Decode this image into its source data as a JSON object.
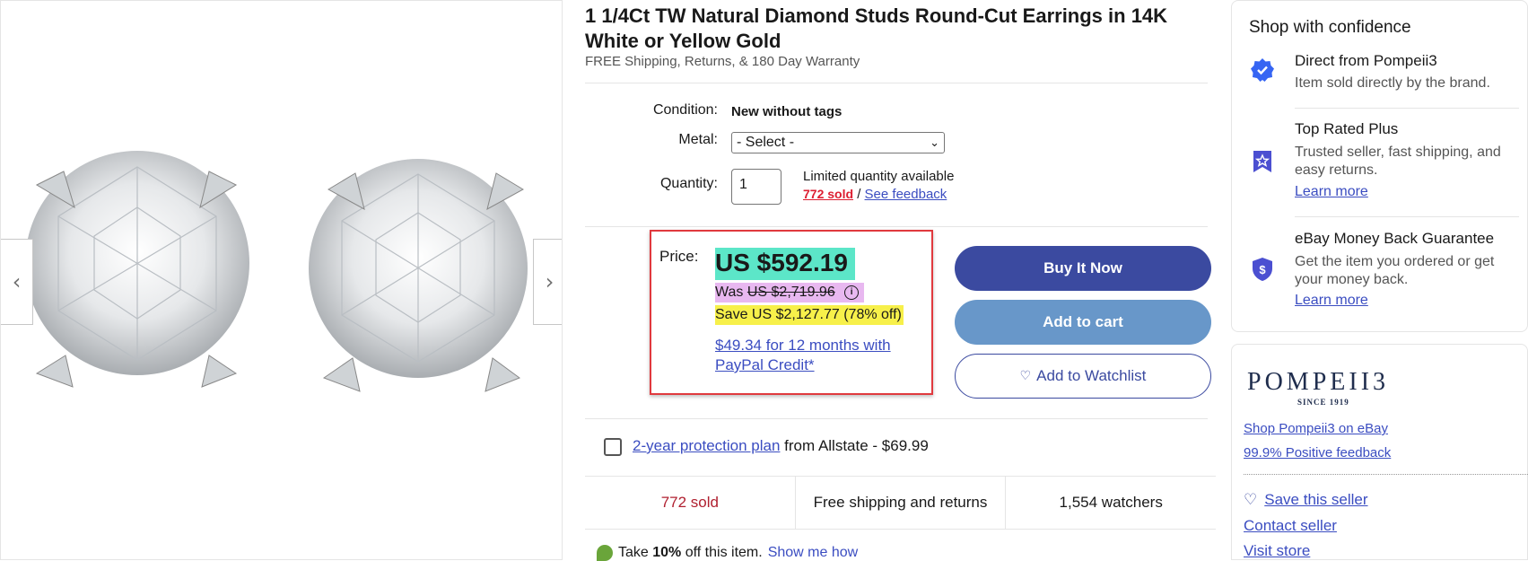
{
  "listing": {
    "title": "1 1/4Ct TW Natural Diamond Studs Round-Cut Earrings in 14K White or Yellow Gold",
    "subtitle": "FREE Shipping, Returns, & 180 Day Warranty"
  },
  "gallery": {
    "prev_icon": "‹",
    "next_icon": "›"
  },
  "details": {
    "condition_label": "Condition:",
    "condition_value": "New without tags",
    "metal_label": "Metal:",
    "metal_select": "- Select -",
    "quantity_label": "Quantity:",
    "quantity_value": "1",
    "limited_text": "Limited quantity available",
    "sold_link": "772 sold",
    "separator": "/",
    "feedback_link": "See feedback"
  },
  "price": {
    "label": "Price:",
    "main": "US $592.19",
    "was_prefix": "Was",
    "was_value": "US $2,719.96",
    "save": "Save US $2,127.77 (78% off)",
    "paypal": "$49.34 for 12 months with PayPal Credit*"
  },
  "actions": {
    "buy_now": "Buy It Now",
    "add_to_cart": "Add to cart",
    "watchlist_icon": "♡",
    "watchlist": "Add to Watchlist"
  },
  "protection": {
    "link": "2-year protection plan",
    "rest": " from Allstate - $69.99"
  },
  "stats": {
    "sold": "772 sold",
    "shipping": "Free shipping and returns",
    "watchers": "1,554 watchers"
  },
  "promo": {
    "prefix": "Take ",
    "bold": "10%",
    "suffix": " off this item.",
    "link": "Show me how"
  },
  "confidence": {
    "title": "Shop with confidence",
    "items": [
      {
        "title": "Direct from Pompeii3",
        "desc": "Item sold directly by the brand.",
        "link": ""
      },
      {
        "title": "Top Rated Plus",
        "desc": "Trusted seller, fast shipping, and easy returns.",
        "link": "Learn more"
      },
      {
        "title": "eBay Money Back Guarantee",
        "desc": "Get the item you ordered or get your money back.",
        "link": "Learn more"
      }
    ]
  },
  "seller": {
    "logo": "POMPEII3",
    "since": "SINCE 1919",
    "shop_link": "Shop Pompeii3 on eBay",
    "feedback_link": "99.9% Positive feedback",
    "save_icon": "♡",
    "save": "Save this seller",
    "contact": "Contact seller",
    "visit": "Visit store"
  },
  "colors": {
    "accent": "#3b4aa0",
    "link": "#3b4dc1",
    "price_highlight": "#5ce6c8",
    "save_highlight": "#f7f04a",
    "was_highlight": "#e8b8f0",
    "sold_red": "#dd1e31"
  }
}
